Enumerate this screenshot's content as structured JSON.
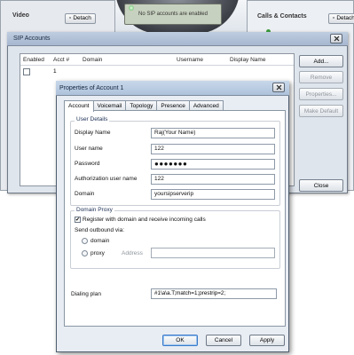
{
  "background": {
    "video_title": "Video",
    "calls_title": "Calls & Contacts",
    "detach_label": "Detach",
    "phone_status": "No SIP accounts are enabled"
  },
  "sip_accounts": {
    "title": "SIP Accounts",
    "columns": [
      "Enabled",
      "Acct #",
      "Domain",
      "Username",
      "Display Name"
    ],
    "rows": [
      {
        "enabled": false,
        "acct": "1",
        "domain": "",
        "username": "",
        "display_name": ""
      }
    ],
    "buttons": {
      "add": "Add...",
      "remove": "Remove",
      "properties": "Properties...",
      "make_default": "Make Default",
      "close": "Close"
    }
  },
  "properties": {
    "title": "Properties of Account 1",
    "tabs": [
      "Account",
      "Voicemail",
      "Topology",
      "Presence",
      "Advanced"
    ],
    "active_tab": "Account",
    "user_details": {
      "group_title": "User Details",
      "fields": [
        {
          "label": "Display Name",
          "value": "Raj(Your Name)"
        },
        {
          "label": "User name",
          "value": "122"
        },
        {
          "label": "Password",
          "value": "●●●●●●●"
        },
        {
          "label": "Authorization user name",
          "value": "122"
        },
        {
          "label": "Domain",
          "value": "yoursipserverip"
        }
      ]
    },
    "domain_proxy": {
      "group_title": "Domain Proxy",
      "register_label": "Register with domain and receive incoming calls",
      "register_checked": true,
      "send_via_label": "Send outbound via:",
      "options": [
        "domain",
        "proxy"
      ],
      "address_label": "Address",
      "address_value": ""
    },
    "dialing_plan": {
      "label": "Dialing plan",
      "value": "#1\\a\\a.T;match=1;prestrip=2;"
    },
    "buttons": {
      "ok": "OK",
      "cancel": "Cancel",
      "apply": "Apply"
    }
  }
}
